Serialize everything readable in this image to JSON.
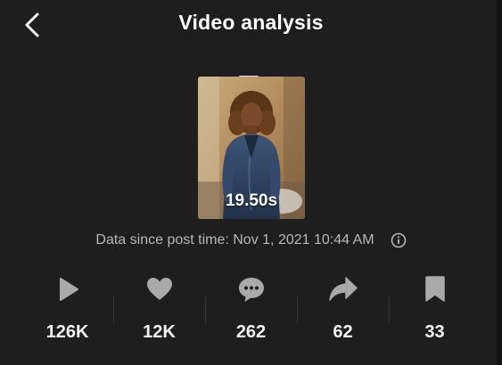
{
  "header": {
    "title": "Video analysis",
    "back_icon": "chevron-left-icon"
  },
  "video": {
    "duration": "19.50s"
  },
  "post_time": {
    "text": "Data since post time: Nov 1, 2021 10:44 AM",
    "info_icon": "info-icon"
  },
  "stats": [
    {
      "icon": "play-icon",
      "value": "126K"
    },
    {
      "icon": "heart-icon",
      "value": "12K"
    },
    {
      "icon": "comment-icon",
      "value": "262"
    },
    {
      "icon": "share-icon",
      "value": "62"
    },
    {
      "icon": "bookmark-icon",
      "value": "33"
    }
  ],
  "colors": {
    "background": "#1e1e1e",
    "icon": "#a9a9a9",
    "secondary_text": "#b7b7b7"
  }
}
